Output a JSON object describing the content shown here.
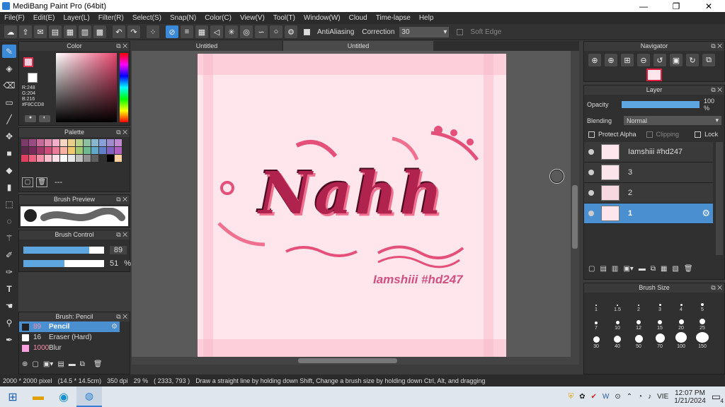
{
  "window": {
    "title": "MediBang Paint Pro (64bit)",
    "minimize": "—",
    "maximize": "❐",
    "close": "✕"
  },
  "menu": [
    "File(F)",
    "Edit(E)",
    "Layer(L)",
    "Filter(R)",
    "Select(S)",
    "Snap(N)",
    "Color(C)",
    "View(V)",
    "Tool(T)",
    "Window(W)",
    "Cloud",
    "Time-lapse",
    "Help"
  ],
  "toolbar": {
    "antialiasing": "AntiAliasing",
    "correction_label": "Correction",
    "correction_value": "30",
    "soft_edge": "Soft Edge"
  },
  "color_panel": {
    "title": "Color",
    "r": "R:248",
    "g": "G:204",
    "b": "B:216",
    "hex": "#F8CCD8",
    "primary": "#f8ccd8"
  },
  "palette_panel": {
    "title": "Palette",
    "footer": "---",
    "colors": [
      "#7a3b69",
      "#9b4a84",
      "#c86b98",
      "#e38bb0",
      "#f2b0c8",
      "#f8d5c0",
      "#e8d08a",
      "#b8d08a",
      "#8cc0a0",
      "#88b8d0",
      "#8aa0d8",
      "#a08ad0",
      "#c08ad0",
      "#5a2a4a",
      "#7a2a5a",
      "#a03a6a",
      "#d04a7a",
      "#e87a9a",
      "#f8b0a0",
      "#f0c870",
      "#a0c870",
      "#70b890",
      "#60a8c8",
      "#6080c8",
      "#8060c0",
      "#b060c0",
      "#e04060",
      "#f06080",
      "#f890a8",
      "#fcc0d0",
      "#ffe0e8",
      "#ffffff",
      "#e8e8e8",
      "#c0c0c0",
      "#909090",
      "#606060",
      "#303030",
      "#000000",
      "#ffd0a0"
    ]
  },
  "brush_preview": {
    "title": "Brush Preview"
  },
  "brush_control": {
    "title": "Brush Control",
    "size": "89",
    "opacity": "51",
    "opacity_unit": "%",
    "size_fraction": 0.82,
    "opacity_fraction": 0.51
  },
  "brush_list": {
    "title": "Brush: Pencil",
    "items": [
      {
        "size": "89",
        "name": "Pencil",
        "selected": true
      },
      {
        "size": "16",
        "name": "Eraser (Hard)",
        "selected": false
      },
      {
        "size": "1000",
        "name": "Blur",
        "selected": false
      }
    ]
  },
  "tabs": [
    "Untitled",
    "Untitled"
  ],
  "canvas_text": {
    "title": "Nahh",
    "credit": "Iamshiii #hd247"
  },
  "navigator": {
    "title": "Navigator"
  },
  "layer_panel": {
    "title": "Layer",
    "opacity_label": "Opacity",
    "opacity_value": "100 %",
    "blending_label": "Blending",
    "blending_value": "Normal",
    "protect_alpha": "Protect Alpha",
    "clipping": "Clipping",
    "lock": "Lock",
    "layers": [
      {
        "name": "Iamshiii #hd247",
        "selected": false
      },
      {
        "name": "3",
        "selected": false
      },
      {
        "name": "2",
        "selected": false
      },
      {
        "name": "1",
        "selected": true
      }
    ]
  },
  "brush_size_panel": {
    "title": "Brush Size",
    "sizes": [
      "1",
      "1.5",
      "2",
      "3",
      "4",
      "5",
      "7",
      "10",
      "12",
      "15",
      "20",
      "25",
      "30",
      "40",
      "50",
      "70",
      "100",
      "150"
    ]
  },
  "status": {
    "size": "2000 * 2000 pixel",
    "cm": "(14.5 * 14.5cm)",
    "dpi": "350 dpi",
    "zoom": "29 %",
    "coords": "( 2333, 793 )",
    "hint": "Draw a straight line by holding down Shift, Change a brush size by holding down Ctrl, Alt, and dragging"
  },
  "taskbar": {
    "lang": "VIE",
    "time": "12:07 PM",
    "date": "1/21/2024",
    "notif": "4"
  }
}
